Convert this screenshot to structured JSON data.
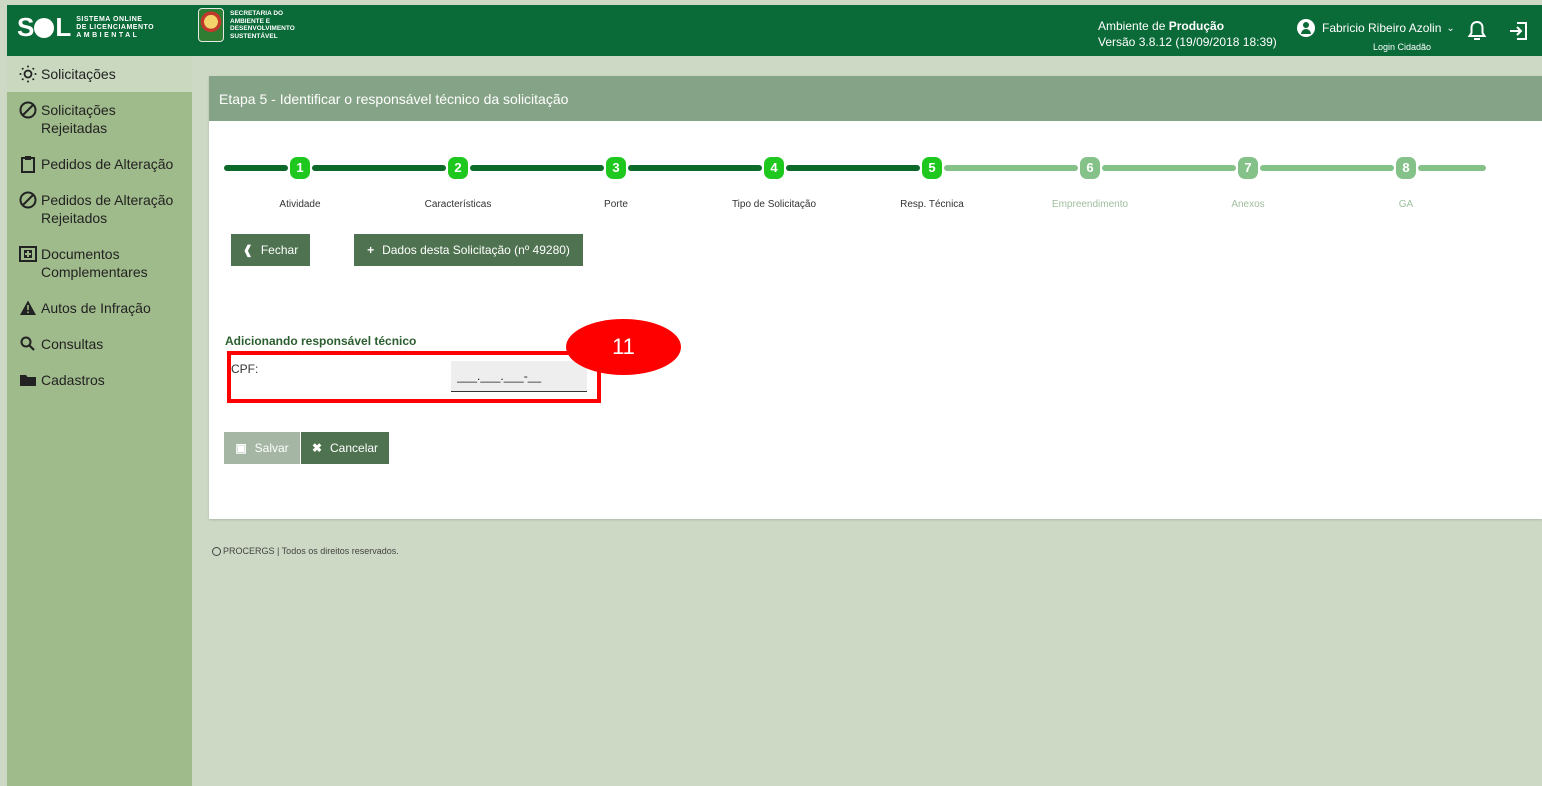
{
  "header": {
    "logo_text": "SOL",
    "logo_sub": [
      "SISTEMA ONLINE",
      "DE LICENCIAMENTO",
      "AMBIENTAL"
    ],
    "secretaria": [
      "SECRETARIA DO",
      "AMBIENTE E",
      "DESENVOLVIMENTO",
      "SUSTENTÁVEL"
    ],
    "environment_prefix": "Ambiente de ",
    "environment_name": "Produção",
    "version": "Versão 3.8.12 (19/09/2018 18:39)",
    "user_name": "Fabricio Ribeiro Azolin",
    "login_type": "Login Cidadão"
  },
  "sidebar": {
    "items": [
      {
        "label": "Solicitações",
        "icon": "sun-icon",
        "active": true
      },
      {
        "label": "Solicitações Rejeitadas",
        "icon": "ban-icon"
      },
      {
        "label": "Pedidos de Alteração",
        "icon": "clipboard-icon"
      },
      {
        "label": "Pedidos de Alteração Rejeitados",
        "icon": "ban-icon"
      },
      {
        "label": "Documentos Complementares",
        "icon": "plus-square-icon"
      },
      {
        "label": "Autos de Infração",
        "icon": "warning-icon"
      },
      {
        "label": "Consultas",
        "icon": "search-icon"
      },
      {
        "label": "Cadastros",
        "icon": "folder-icon"
      }
    ]
  },
  "main": {
    "title": "Etapa 5 - Identificar o responsável técnico da solicitação",
    "steps": [
      {
        "number": "1",
        "label": "Atividade",
        "done": true
      },
      {
        "number": "2",
        "label": "Características",
        "done": true
      },
      {
        "number": "3",
        "label": "Porte",
        "done": true
      },
      {
        "number": "4",
        "label": "Tipo de Solicitação",
        "done": true
      },
      {
        "number": "5",
        "label": "Resp. Técnica",
        "done": true
      },
      {
        "number": "6",
        "label": "Empreendimento",
        "done": false
      },
      {
        "number": "7",
        "label": "Anexos",
        "done": false
      },
      {
        "number": "8",
        "label": "GA",
        "done": false
      }
    ],
    "close_button": "Fechar",
    "details_button": "Dados desta Solicitação (nº 49280)",
    "section_title": "Adicionando responsável técnico",
    "cpf_label": "CPF:",
    "cpf_value": "___.___.___-__",
    "save_button": "Salvar",
    "cancel_button": "Cancelar"
  },
  "annotation": {
    "number": "11"
  },
  "footer": {
    "text": "PROCERGS | Todos os direitos reservados."
  },
  "colors": {
    "topbar": "#0a6a38",
    "sidebar": "#a0bb8b",
    "step_done": "#0c6b2a",
    "step_badge_done": "#1fc81f",
    "step_todo": "#85c28a",
    "highlight": "#ff0000"
  }
}
